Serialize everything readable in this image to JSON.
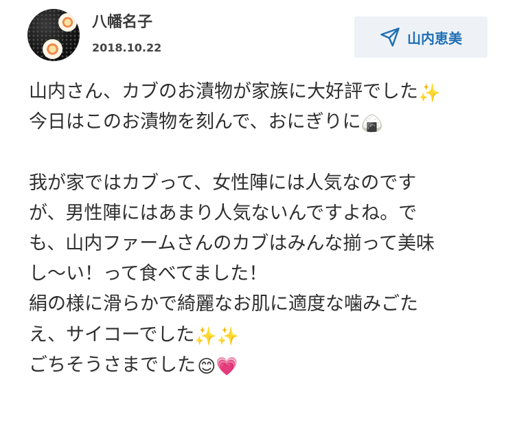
{
  "post": {
    "author_name": "八幡名子",
    "date": "2018.10.22",
    "recipient_button": {
      "label": "山内恵美",
      "icon": "send-icon"
    }
  },
  "message": {
    "lines": [
      {
        "text": "山内さん、カブのお漬物が家族に大好評でした",
        "emoji": "✨"
      },
      {
        "text": "今日はこのお漬物を刻んで、おにぎりに",
        "emoji": "🍙"
      },
      {
        "text": "",
        "emoji": ""
      },
      {
        "text": "我が家ではカブって、女性陣には人気なのです",
        "emoji": ""
      },
      {
        "text": "が、男性陣にはあまり人気ないんですよね。で",
        "emoji": ""
      },
      {
        "text": "も、山内ファームさんのカブはみんな揃って美味",
        "emoji": ""
      },
      {
        "text": "し〜い！って食べてました！",
        "emoji": ""
      },
      {
        "text": "絹の様に滑らかで綺麗なお肌に適度な噛みごた",
        "emoji": ""
      },
      {
        "text": "え、サイコーでした",
        "emoji": "✨✨"
      },
      {
        "text": "ごちそうさまでした",
        "emoji": "😊💗"
      }
    ]
  },
  "colors": {
    "accent": "#1f6fb4",
    "button_bg": "#eef2f6",
    "text": "#2f2f2f"
  }
}
